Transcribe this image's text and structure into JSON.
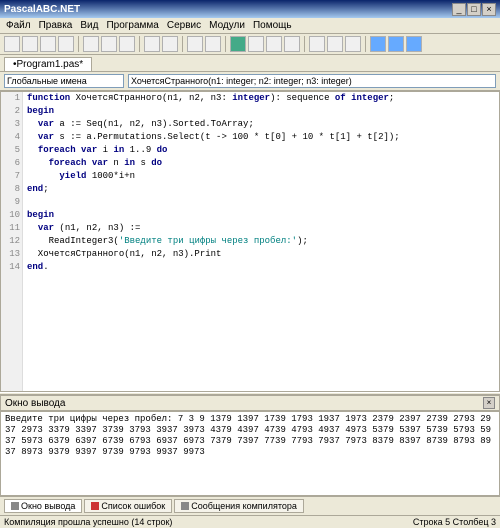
{
  "window": {
    "title": "PascalABC.NET"
  },
  "menu": {
    "file": "Файл",
    "edit": "Правка",
    "view": "Вид",
    "program": "Программа",
    "service": "Сервис",
    "modules": "Модули",
    "help": "Помощь"
  },
  "tabs": {
    "main": "•Program1.pas*"
  },
  "globals": {
    "left": "Глобальные имена",
    "right": "ХочетсяСтранного(n1: integer; n2: integer; n3: integer)"
  },
  "code": {
    "gutter": [
      "1",
      "2",
      "3",
      "4",
      "5",
      "6",
      "7",
      "8",
      "9",
      "10",
      "11",
      "12",
      "13",
      "14"
    ],
    "lines": [
      {
        "pre": "",
        "kw": "function",
        "rest": " ХочетсяСтранного(n1, n2, n3: ",
        "kw2": "integer",
        "rest2": "): sequence ",
        "kw3": "of",
        "rest3": " ",
        "kw4": "integer",
        "rest4": ";"
      },
      {
        "pre": "",
        "kw": "begin",
        "rest": ""
      },
      {
        "pre": "  ",
        "kw": "var",
        "rest": " a := Seq(n1, n2, n3).Sorted.ToArray;"
      },
      {
        "pre": "  ",
        "kw": "var",
        "rest": " s := a.Permutations.Select(t -> 100 * t[0] + 10 * t[1] + t[2]);"
      },
      {
        "pre": "  ",
        "kw": "foreach",
        "rest": " ",
        "kw2": "var",
        "rest2": " i ",
        "kw3": "in",
        "rest3": " 1..9 ",
        "kw4": "do",
        "rest4": ""
      },
      {
        "pre": "    ",
        "kw": "foreach",
        "rest": " ",
        "kw2": "var",
        "rest2": " n ",
        "kw3": "in",
        "rest3": " s ",
        "kw4": "do",
        "rest4": ""
      },
      {
        "pre": "      ",
        "kw": "yield",
        "rest": " 1000*i+n"
      },
      {
        "pre": "",
        "kw": "end",
        "rest": ";"
      },
      {
        "pre": "",
        "kw": "",
        "rest": ""
      },
      {
        "pre": "",
        "kw": "begin",
        "rest": ""
      },
      {
        "pre": "  ",
        "kw": "var",
        "rest": " (n1, n2, n3) :="
      },
      {
        "pre": "    ",
        "kw": "",
        "rest": "ReadInteger3(",
        "str": "'Введите три цифры через пробел:'",
        "rest2": ");"
      },
      {
        "pre": "  ",
        "kw": "",
        "rest": "ХочетсяСтранного(n1, n2, n3).Print"
      },
      {
        "pre": "",
        "kw": "end",
        "rest": "."
      }
    ]
  },
  "output": {
    "title": "Окно вывода",
    "text": "Введите три цифры через пробел: 7 3 9\n1379 1397 1739 1793 1937 1973 2379 2397 2739 2793 2937 2973 3379 3397 3739 3793 3937 3973 4379 4397 4739 4793 4937 4973 5379 5397 5739 5793 5937 5973 6379 6397 6739 6793 6937 6973 7379 7397 7739 7793 7937 7973 8379 8397 8739 8793 8937 8973 9379 9397 9739 9793 9937 9973"
  },
  "bottom_tabs": {
    "out": "Окно вывода",
    "errors": "Список ошибок",
    "compiler": "Сообщения компилятора"
  },
  "status": {
    "compile": "Компиляция прошла успешно (14 строк)",
    "pos": "Строка  5 Столбец  3"
  },
  "winbtns": {
    "min": "_",
    "max": "□",
    "close": "×"
  }
}
